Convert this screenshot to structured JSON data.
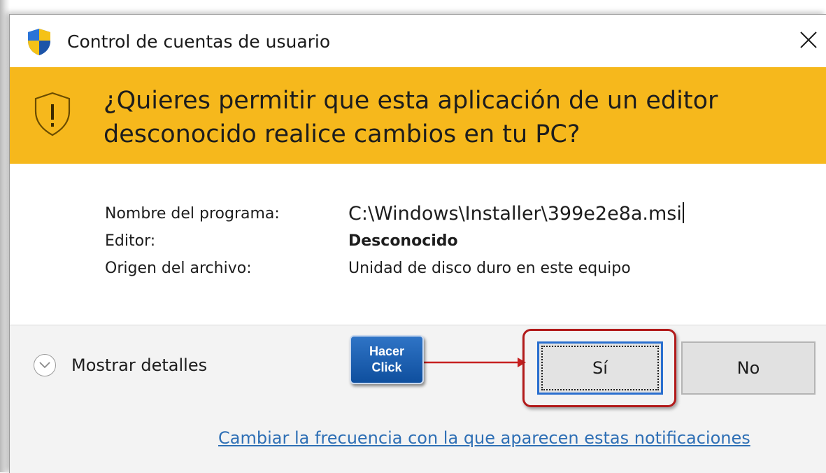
{
  "window": {
    "title": "Control de cuentas de usuario",
    "close_glyph": "✕"
  },
  "banner": {
    "question": "¿Quieres permitir que esta aplicación de un editor desconocido realice cambios en tu PC?",
    "color": "#f6b81c"
  },
  "details": {
    "program_label": "Nombre del programa:",
    "program_value": "C:\\Windows\\Installer\\399e2e8a.msi",
    "publisher_label": "Editor:",
    "publisher_value": "Desconocido",
    "origin_label": "Origen del archivo:",
    "origin_value": "Unidad de disco duro en este equipo"
  },
  "footer": {
    "show_details_label": "Mostrar detalles",
    "yes_label": "Sí",
    "no_label": "No",
    "notifications_link": "Cambiar la frecuencia con la que aparecen estas notificaciones"
  },
  "annotation": {
    "hint_line1": "Hacer",
    "hint_line2": "Click",
    "highlight_color": "#b21a1a",
    "badge_color": "#1b5fae"
  },
  "icons": {
    "app": "uac-shield-icon",
    "warning": "warning-shield-icon",
    "close": "close-icon",
    "expand": "chevron-down-icon"
  }
}
